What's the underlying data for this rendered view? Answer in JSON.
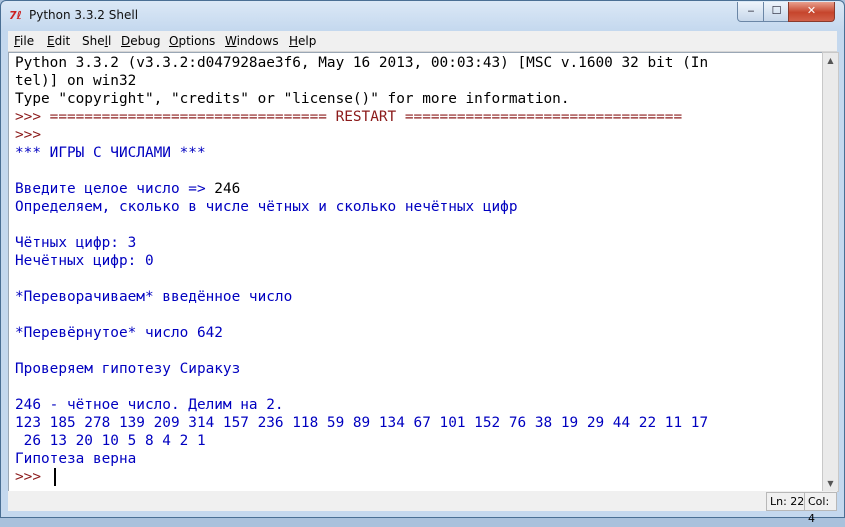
{
  "window": {
    "title": "Python 3.3.2 Shell",
    "icon": "python-idle-icon",
    "buttons": {
      "minimize": "‒",
      "maximize": "☐",
      "close": "✕"
    }
  },
  "menubar": {
    "items": [
      {
        "prefix": "",
        "underline": "F",
        "rest": "ile"
      },
      {
        "prefix": "",
        "underline": "E",
        "rest": "dit"
      },
      {
        "prefix": "She",
        "underline": "l",
        "rest": "l"
      },
      {
        "prefix": "",
        "underline": "D",
        "rest": "ebug"
      },
      {
        "prefix": "",
        "underline": "O",
        "rest": "ptions"
      },
      {
        "prefix": "",
        "underline": "W",
        "rest": "indows"
      },
      {
        "prefix": "",
        "underline": "H",
        "rest": "elp"
      }
    ]
  },
  "shell": {
    "lines": [
      "Python 3.3.2 (v3.3.2:d047928ae3f6, May 16 2013, 00:03:43) [MSC v.1600 32 bit (In",
      "tel)] on win32",
      "Type \"copyright\", \"credits\" or \"license()\" for more information.",
      ">>> ================================ RESTART ================================",
      ">>>",
      "*** ИГРЫ С ЧИСЛАМИ ***",
      "",
      "Введите целое число => ",
      "Определяем, сколько в числе чётных и сколько нечётных цифр",
      "",
      "Чётных цифр: 3",
      "Нечётных цифр: 0",
      "",
      "*Переворачиваем* введённое число",
      "",
      "*Перевёрнутое* число 642",
      "",
      "Проверяем гипотезу Сиракуз",
      "",
      "246 - чётное число. Делим на 2.",
      "123 185 278 139 209 314 157 236 118 59 89 134 67 101 152 76 38 19 29 44 22 11 17",
      " 26 13 20 10 5 8 4 2 1",
      "Гипотеза верна",
      ">>> "
    ],
    "user_input": "246"
  },
  "status": {
    "line": "Ln: 22",
    "col": "Col: 4"
  },
  "colors": {
    "output": "#0000c0",
    "prompt": "#8b1a1a",
    "text": "#000000"
  }
}
